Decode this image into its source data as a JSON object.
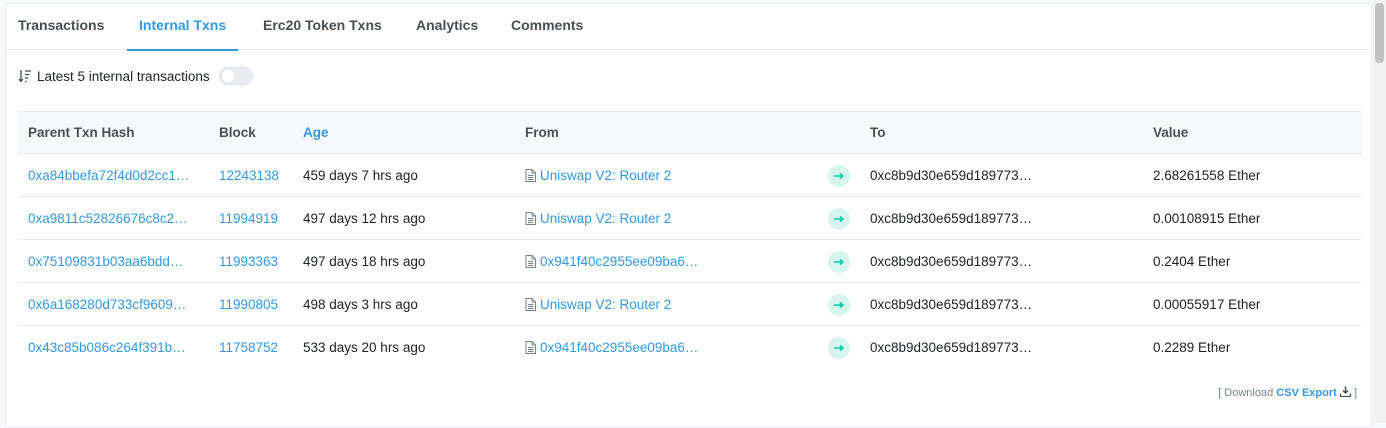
{
  "tabs": [
    {
      "label": "Transactions",
      "active": false
    },
    {
      "label": "Internal Txns",
      "active": true
    },
    {
      "label": "Erc20 Token Txns",
      "active": false
    },
    {
      "label": "Analytics",
      "active": false
    },
    {
      "label": "Comments",
      "active": false
    }
  ],
  "summary": {
    "text": "Latest 5 internal transactions",
    "toggle_on": false
  },
  "table": {
    "headers": {
      "parent_txn_hash": "Parent Txn Hash",
      "block": "Block",
      "age": "Age",
      "from": "From",
      "to": "To",
      "value": "Value"
    },
    "rows": [
      {
        "hash": "0xa84bbefa72f4d0d2cc1…",
        "block": "12243138",
        "age": "459 days 7 hrs ago",
        "from": "Uniswap V2: Router 2",
        "to": "0xc8b9d30e659d189773…",
        "value": "2.68261558 Ether"
      },
      {
        "hash": "0xa9811c52826676c8c2…",
        "block": "11994919",
        "age": "497 days 12 hrs ago",
        "from": "Uniswap V2: Router 2",
        "to": "0xc8b9d30e659d189773…",
        "value": "0.00108915 Ether"
      },
      {
        "hash": "0x75109831b03aa6bdd…",
        "block": "11993363",
        "age": "497 days 18 hrs ago",
        "from": "0x941f40c2955ee09ba6…",
        "to": "0xc8b9d30e659d189773…",
        "value": "0.2404 Ether"
      },
      {
        "hash": "0x6a168280d733cf9609…",
        "block": "11990805",
        "age": "498 days 3 hrs ago",
        "from": "Uniswap V2: Router 2",
        "to": "0xc8b9d30e659d189773…",
        "value": "0.00055917 Ether"
      },
      {
        "hash": "0x43c85b086c264f391b…",
        "block": "11758752",
        "age": "533 days 20 hrs ago",
        "from": "0x941f40c2955ee09ba6…",
        "to": "0xc8b9d30e659d189773…",
        "value": "0.2289 Ether"
      }
    ]
  },
  "footer": {
    "prefix": "[ Download",
    "csv_label": "CSV Export",
    "suffix": "]"
  },
  "icons": {
    "sort": "sort-desc-icon",
    "contract": "file-icon",
    "arrow": "arrow-right-icon",
    "download": "download-icon"
  },
  "colors": {
    "accent": "#3498db",
    "text": "#1e2022",
    "muted": "#77838f",
    "arrow_bg": "#d6f5ec",
    "arrow_fg": "#00c9a7"
  }
}
